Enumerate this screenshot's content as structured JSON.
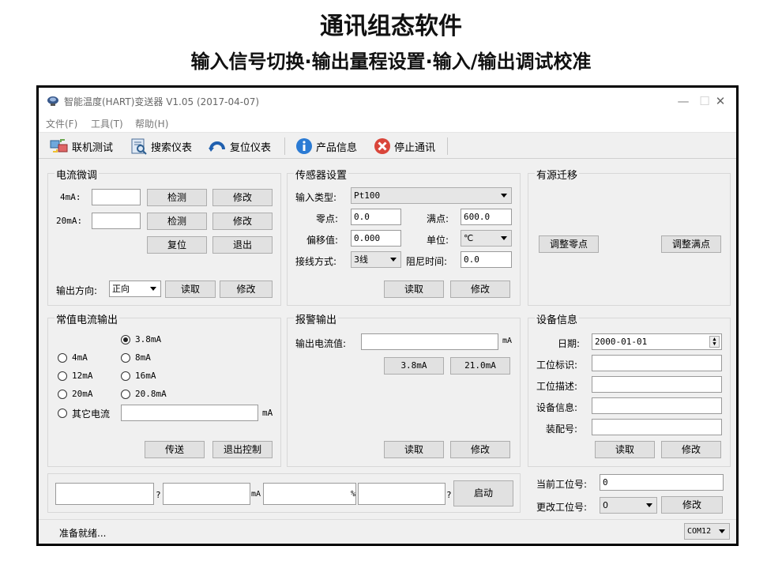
{
  "banner": {
    "title": "通讯组态软件",
    "subtitle": "输入信号切换·输出量程设置·输入/输出调试校准"
  },
  "window": {
    "title": "智能温度(HART)变送器 V1.05 (2017-04-07)",
    "controls": {
      "minimize": "—",
      "maximize": "☐",
      "close": "✕"
    }
  },
  "menu": {
    "file": "文件(F)",
    "tools": "工具(T)",
    "help": "帮助(H)"
  },
  "toolbar": {
    "connect": "联机测试",
    "search": "搜索仪表",
    "reset": "复位仪表",
    "info": "产品信息",
    "stop": "停止通讯"
  },
  "current_trim": {
    "title": "电流微调",
    "label_4ma": "4mA:",
    "label_20ma": "20mA:",
    "value_4ma": "",
    "value_20ma": "",
    "detect": "检测",
    "modify": "修改",
    "reset": "复位",
    "exit": "退出",
    "direction_label": "输出方向:",
    "direction_value": "正向",
    "read": "读取",
    "write": "修改"
  },
  "sensor": {
    "title": "传感器设置",
    "type_label": "输入类型:",
    "type_value": "Pt100",
    "zero_label": "零点:",
    "zero_value": "0.0",
    "full_label": "满点:",
    "full_value": "600.0",
    "offset_label": "偏移值:",
    "offset_value": "0.000",
    "unit_label": "单位:",
    "unit_value": "℃",
    "wiring_label": "接线方式:",
    "wiring_value": "3线",
    "damping_label": "阻尼时间:",
    "damping_value": "0.0",
    "read": "读取",
    "write": "修改"
  },
  "source_shift": {
    "title": "有源迁移",
    "zero": "调整零点",
    "full": "调整满点"
  },
  "const_output": {
    "title": "常值电流输出",
    "options": [
      "3.8mA",
      "4mA",
      "8mA",
      "12mA",
      "16mA",
      "20mA",
      "20.8mA"
    ],
    "other_label": "其它电流",
    "other_value": "",
    "unit": "mA",
    "send": "传送",
    "exit": "退出控制"
  },
  "alarm": {
    "title": "报警输出",
    "label": "输出电流值:",
    "value": "",
    "unit": "mA",
    "low": "3.8mA",
    "high": "21.0mA",
    "read": "读取",
    "write": "修改"
  },
  "device": {
    "title": "设备信息",
    "date_label": "日期:",
    "date_value": "2000-01-01",
    "tag_label": "工位标识:",
    "tag_value": "",
    "desc_label": "工位描述:",
    "desc_value": "",
    "msg_label": "设备信息:",
    "msg_value": "",
    "assembly_label": "装配号:",
    "assembly_value": "",
    "read": "读取",
    "write": "修改"
  },
  "monitor": {
    "field1": "",
    "sep1": "?",
    "field2": "",
    "sep2": "mA",
    "field3": "",
    "sep3": "%",
    "field4": "",
    "sep4": "?",
    "start": "启动"
  },
  "address": {
    "current_label": "当前工位号:",
    "current_value": "0",
    "change_label": "更改工位号:",
    "change_value": "0",
    "write": "修改"
  },
  "status": {
    "text": "准备就绪...",
    "port": "COM12"
  }
}
